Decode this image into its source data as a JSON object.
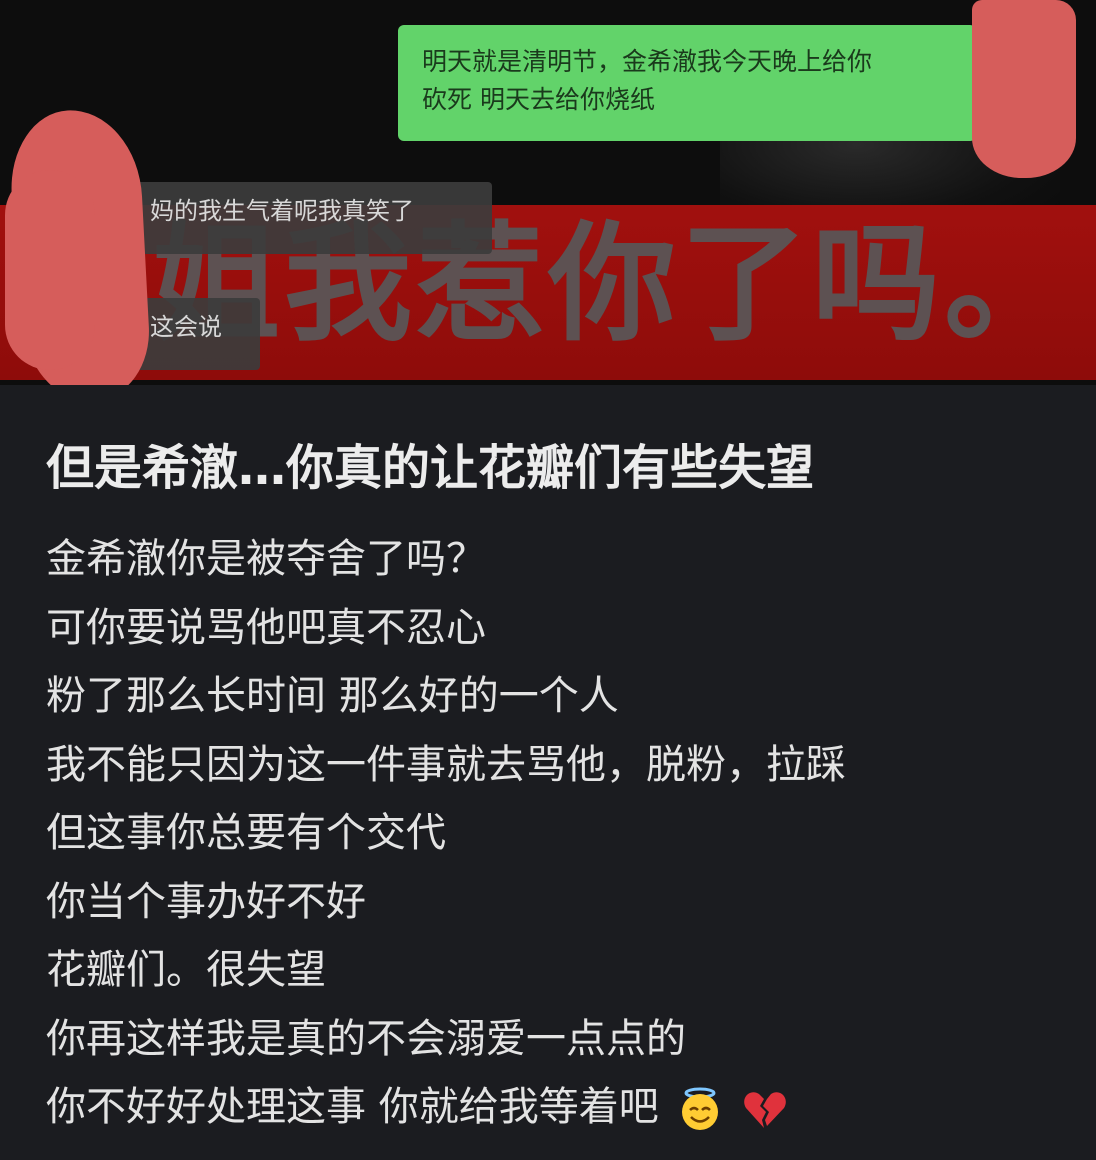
{
  "chat_image": {
    "green_bubble_lines": [
      "明天就是清明节，金希澈我今天晚上给你",
      "砍死 明天去给你烧纸"
    ],
    "gray_bubble_1": "妈的我生气着呢我真笑了",
    "gray_bubble_2": "这会说",
    "banner_text": "阳姐我惹你了吗。"
  },
  "post": {
    "title": "但是希澈…你真的让花瓣们有些失望",
    "lines": [
      "金希澈你是被夺舍了吗？",
      "可你要说骂他吧真不忍心",
      "粉了那么长时间 那么好的一个人",
      "我不能只因为这一件事就去骂他，脱粉，拉踩",
      "但这事你总要有个交代",
      "你当个事办好不好",
      "花瓣们。很失望",
      "你再这样我是真的不会溺爱一点点的",
      "你不好好处理这事 你就给我等着吧"
    ],
    "emojis": [
      "smiling-face-with-halo-icon",
      "broken-heart-icon"
    ]
  },
  "colors": {
    "green_bubble": "#62d36a",
    "red_banner": "#a1100e",
    "redaction": "#d65d5b",
    "background": "#1b1c20"
  }
}
